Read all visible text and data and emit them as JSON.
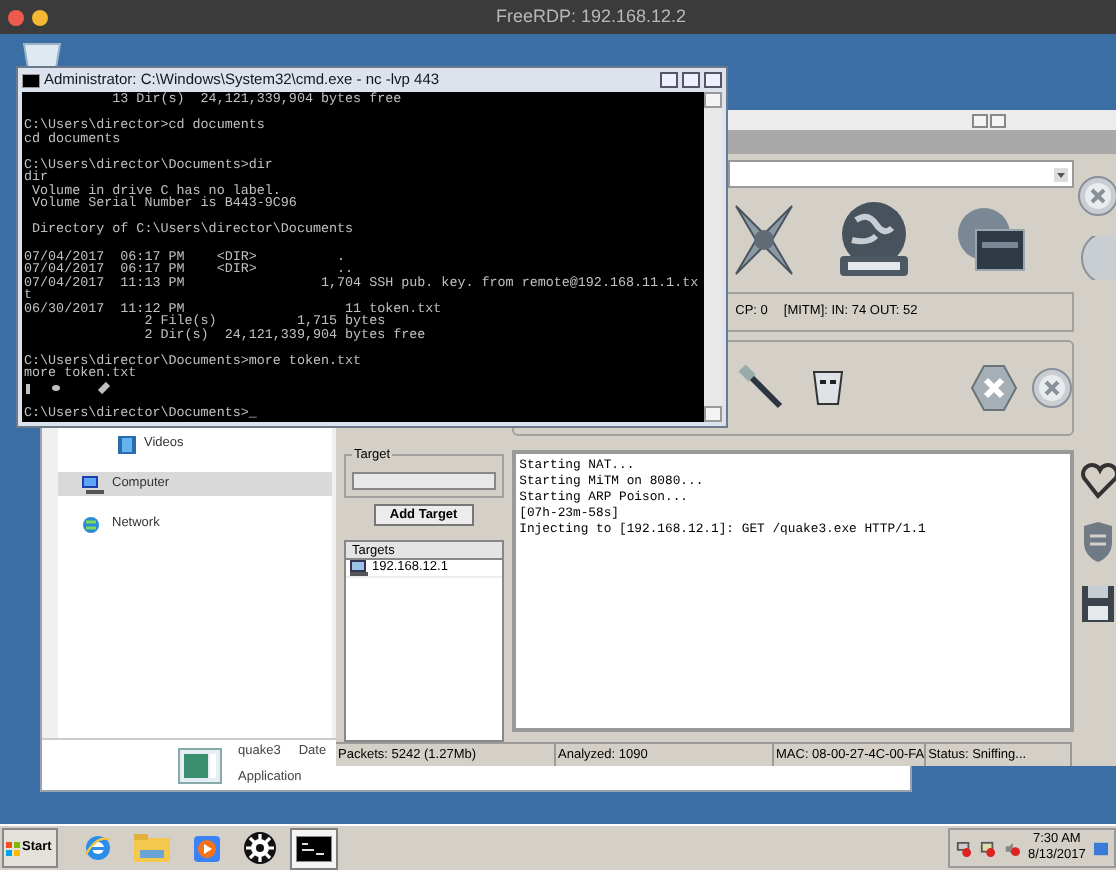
{
  "remote_window": {
    "title": "FreeRDP: 192.168.12.2"
  },
  "cmd": {
    "title": "Administrator: C:\\Windows\\System32\\cmd.exe - nc  -lvp 443",
    "lines": [
      {
        "kind": "text",
        "text": "           13 Dir(s)  24,121,339,904 bytes free"
      },
      {
        "kind": "blank"
      },
      {
        "kind": "text",
        "text": "C:\\Users\\director>cd documents"
      },
      {
        "kind": "text",
        "text": "cd documents"
      },
      {
        "kind": "blank"
      },
      {
        "kind": "text",
        "text": "C:\\Users\\director\\Documents>dir"
      },
      {
        "kind": "text",
        "text": "dir"
      },
      {
        "kind": "text",
        "text": " Volume in drive C has no label."
      },
      {
        "kind": "text",
        "text": " Volume Serial Number is B443-9C96"
      },
      {
        "kind": "blank"
      },
      {
        "kind": "text",
        "text": " Directory of C:\\Users\\director\\Documents"
      },
      {
        "kind": "blank"
      },
      {
        "kind": "text",
        "text": "07/04/2017  06:17 PM    <DIR>          ."
      },
      {
        "kind": "text",
        "text": "07/04/2017  06:17 PM    <DIR>          .."
      },
      {
        "kind": "text",
        "text": "07/04/2017  11:13 PM                 1,704 SSH pub. key. from remote@192.168.11.1.tx"
      },
      {
        "kind": "text",
        "text": "t"
      },
      {
        "kind": "text",
        "text": "06/30/2017  11:12 PM                    11 token.txt"
      },
      {
        "kind": "text",
        "text": "               2 File(s)          1,715 bytes"
      },
      {
        "kind": "text",
        "text": "               2 Dir(s)  24,121,339,904 bytes free"
      },
      {
        "kind": "blank"
      },
      {
        "kind": "text",
        "text": "C:\\Users\\director\\Documents>more token.txt"
      },
      {
        "kind": "text",
        "text": "more token.txt"
      },
      {
        "kind": "garbled"
      },
      {
        "kind": "blank"
      },
      {
        "kind": "text",
        "text": "C:\\Users\\director\\Documents>_"
      }
    ]
  },
  "explorer": {
    "nav": [
      {
        "label": "Videos",
        "selected": false,
        "kind": "videos"
      },
      {
        "label": "Computer",
        "selected": true,
        "kind": "computer"
      },
      {
        "label": "Network",
        "selected": false,
        "kind": "network"
      }
    ],
    "details": {
      "name": "quake3",
      "column": "Date",
      "type": "Application"
    }
  },
  "tool": {
    "stats": [
      "CP: 0",
      "[MITM]: IN: 74 OUT: 52"
    ],
    "target_label": "Target",
    "add_button": "Add Target",
    "targets_header": "Targets",
    "targets": [
      "192.168.12.1"
    ],
    "log": [
      "Starting NAT...",
      "Starting MiTM on 8080...",
      "Starting ARP Poison...",
      "[07h-23m-58s]",
      "Injecting to [192.168.12.1]: GET /quake3.exe HTTP/1.1"
    ],
    "status": [
      "Packets: 5242 (1.27Mb)",
      "Analyzed: 1090",
      "MAC: 08-00-27-4C-00-FA",
      "Status: Sniffing..."
    ]
  },
  "taskbar": {
    "start": "Start",
    "apps": [
      {
        "kind": "browser",
        "active": false
      },
      {
        "kind": "folder",
        "active": false
      },
      {
        "kind": "media",
        "active": false
      },
      {
        "kind": "gear",
        "active": false
      },
      {
        "kind": "console",
        "active": true
      }
    ],
    "time": "7:30 AM",
    "date": "8/13/2017"
  }
}
